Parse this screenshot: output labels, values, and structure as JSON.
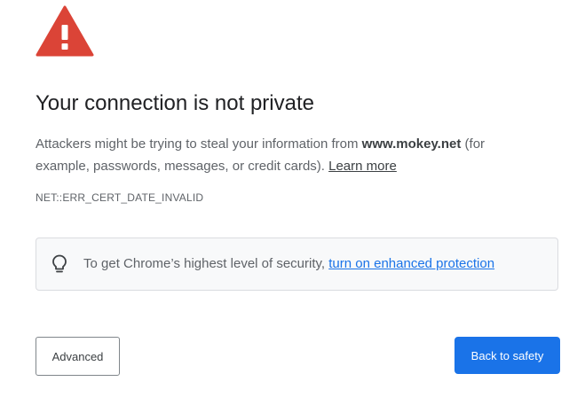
{
  "icon": "warning-triangle-icon",
  "title": "Your connection is not private",
  "description": {
    "before_host": "Attackers might be trying to steal your information from ",
    "host": "www.mokey.net",
    "after_host": " (for example, passwords, messages, or credit cards). ",
    "learn_more": "Learn more"
  },
  "error_code": "NET::ERR_CERT_DATE_INVALID",
  "callout": {
    "icon": "lightbulb-icon",
    "text": "To get Chrome’s highest level of security, ",
    "link": "turn on enhanced protection"
  },
  "buttons": {
    "advanced": "Advanced",
    "back_to_safety": "Back to safety"
  },
  "colors": {
    "warning_red": "#db4437",
    "primary_blue": "#1a73e8",
    "title_text": "#202124",
    "body_text": "#5f6368"
  }
}
